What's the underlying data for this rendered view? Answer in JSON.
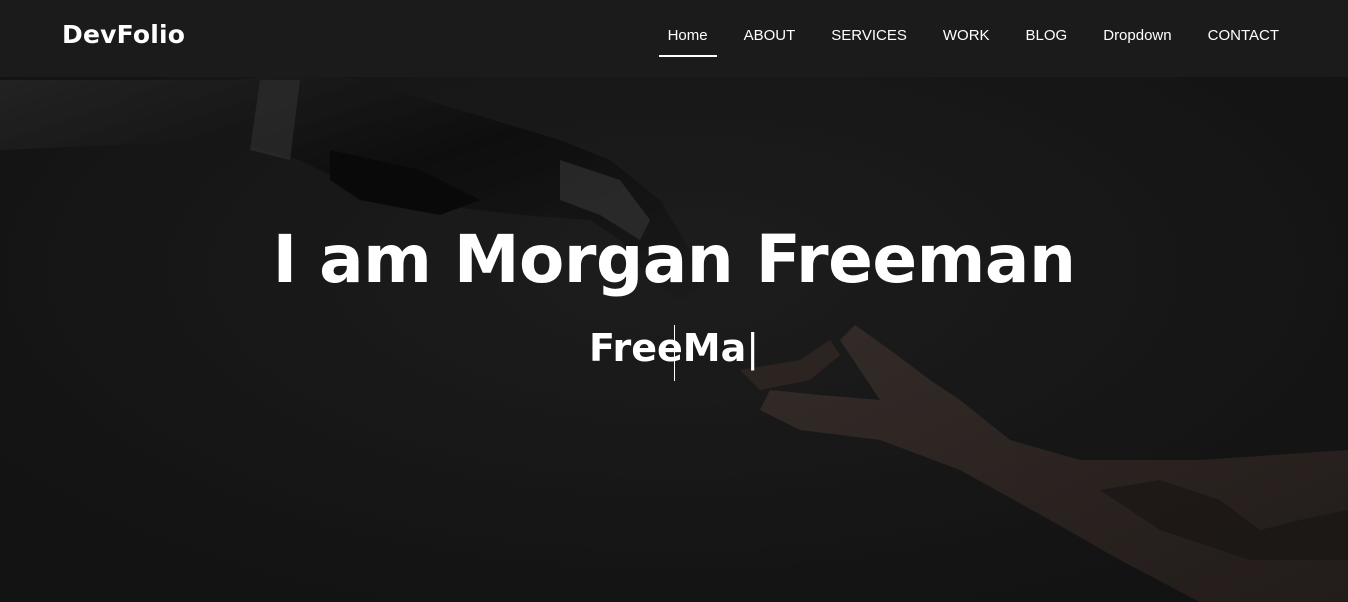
{
  "brand": "DevFolio",
  "nav": [
    {
      "label": "Home",
      "active": true
    },
    {
      "label": "ABOUT"
    },
    {
      "label": "SERVICES"
    },
    {
      "label": "WORK"
    },
    {
      "label": "BLOG"
    },
    {
      "label": "Dropdown"
    },
    {
      "label": "CONTACT"
    }
  ],
  "hero": {
    "title": "I am Morgan Freeman",
    "typed_text": "FreeMa",
    "cursor": "|",
    "background_image": "robot-hand-touching-human-hand"
  },
  "colors": {
    "navbar": "#1b1b1b",
    "text": "#ffffff",
    "hero_bg": "#242424"
  }
}
